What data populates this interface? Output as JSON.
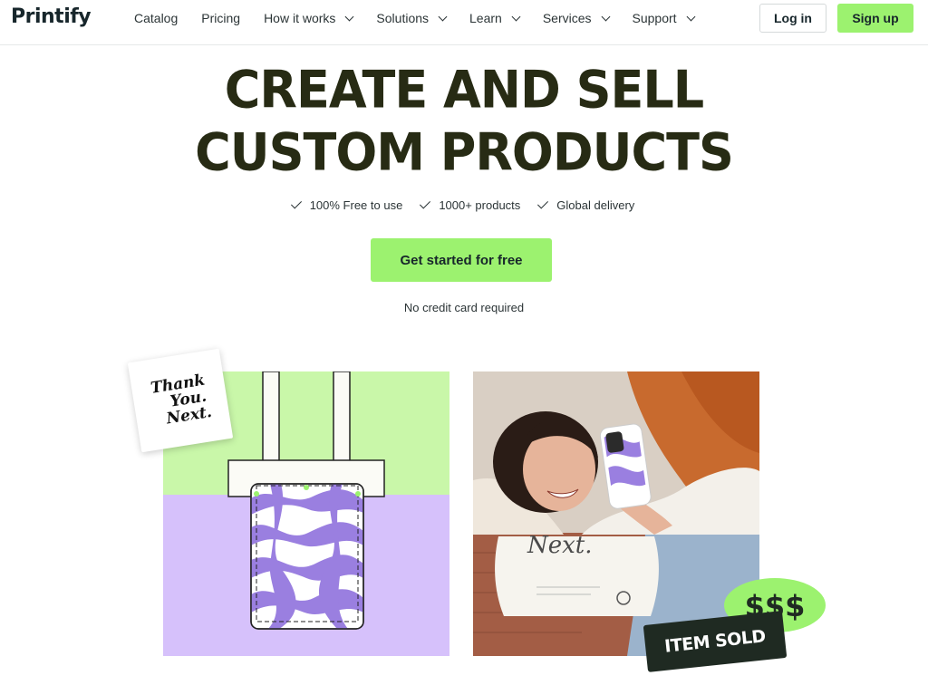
{
  "brand": {
    "logo_text": "Printify"
  },
  "nav": {
    "items": [
      {
        "label": "Catalog",
        "has_dropdown": false
      },
      {
        "label": "Pricing",
        "has_dropdown": false
      },
      {
        "label": "How it works",
        "has_dropdown": true
      },
      {
        "label": "Solutions",
        "has_dropdown": true
      },
      {
        "label": "Learn",
        "has_dropdown": true
      },
      {
        "label": "Services",
        "has_dropdown": true
      },
      {
        "label": "Support",
        "has_dropdown": true
      }
    ],
    "login_label": "Log in",
    "signup_label": "Sign up"
  },
  "hero": {
    "title_line1": "CREATE AND SELL",
    "title_line2": "CUSTOM PRODUCTS",
    "features": [
      "100% Free to use",
      "1000+ products",
      "Global delivery"
    ],
    "cta_label": "Get started for free",
    "note": "No credit card required"
  },
  "images": {
    "sticker_lines": [
      "Thank",
      "You.",
      "Next."
    ],
    "money_badge": "$$$",
    "sold_badge": "ITEM SOLD",
    "bag_print": "Next."
  },
  "colors": {
    "accent_green": "#9cf26f",
    "title_dark": "#272b14",
    "panel_green": "#c9f7a9",
    "panel_purple": "#d6c1fb",
    "swirl_purple": "#9a7fe0"
  }
}
